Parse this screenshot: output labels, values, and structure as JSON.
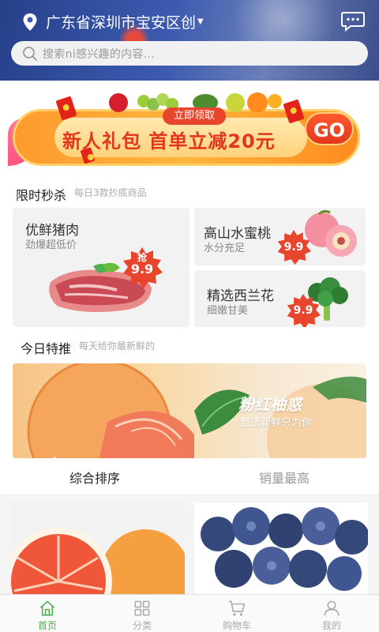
{
  "header": {
    "location": "广东省深圳市宝安区创",
    "search_placeholder": "搜索ni感兴趣的内容..."
  },
  "banner": {
    "pill": "立即领取",
    "title": "新人礼包  首单立减20元",
    "go": "GO"
  },
  "flash_sale": {
    "title": "限时秒杀",
    "subtitle": "每日3款抄底商品",
    "cards": [
      {
        "title": "优鲜猪肉",
        "sub": "劲爆超低价",
        "badge_top": "抢",
        "price": "9.9"
      },
      {
        "title": "高山水蜜桃",
        "sub": "水分充足",
        "price": "9.9"
      },
      {
        "title": "精选西兰花",
        "sub": "细嫩甘美",
        "price": "9.9"
      }
    ]
  },
  "daily": {
    "title": "今日特推",
    "subtitle": "每天给你最新鲜的"
  },
  "promo": {
    "headline": "粉红柚惑",
    "sub": "甄选新鲜只为你"
  },
  "sort_tabs": [
    {
      "label": "综合排序",
      "active": true
    },
    {
      "label": "销量最高",
      "active": false
    }
  ],
  "bottom_nav": [
    {
      "label": "首页",
      "icon": "home-icon",
      "active": true
    },
    {
      "label": "分类",
      "icon": "grid-icon",
      "active": false
    },
    {
      "label": "购物车",
      "icon": "cart-icon",
      "active": false
    },
    {
      "label": "我的",
      "icon": "user-icon",
      "active": false
    }
  ],
  "colors": {
    "accent_green": "#4caf50",
    "price_red": "#e8452d",
    "header_blue": "#3c5bb0"
  }
}
